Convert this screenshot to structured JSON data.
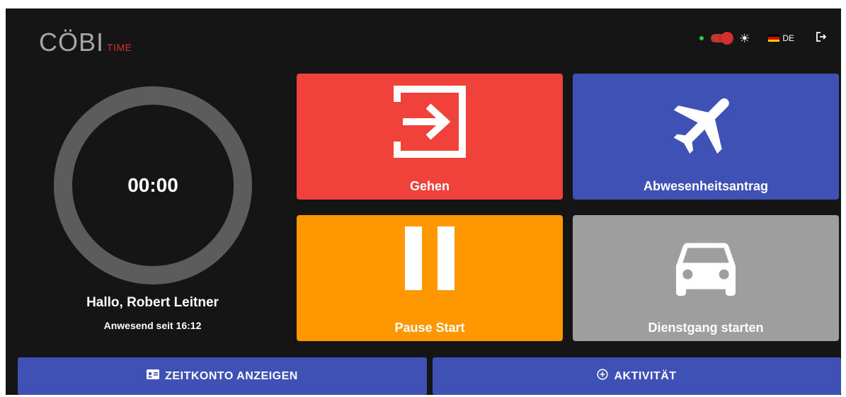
{
  "colors": {
    "background": "#151515",
    "gehen": "#f0413b",
    "absence": "#3f51b5",
    "pause": "#ff9800",
    "errand": "#9e9e9e",
    "button": "#3f51b5",
    "ring": "#5c5c5c"
  },
  "header": {
    "logo_main": "CÖBI",
    "logo_sub": "TIME",
    "language": "DE"
  },
  "timer": {
    "value": "00:00",
    "greeting": "Hallo, Robert Leitner",
    "status": "Anwesend seit 16:12"
  },
  "tiles": [
    {
      "label": "Gehen",
      "icon": "sign-out-icon"
    },
    {
      "label": "Abwesenheitsantrag",
      "icon": "airplane-icon"
    },
    {
      "label": "Pause Start",
      "icon": "pause-icon"
    },
    {
      "label": "Dienstgang starten",
      "icon": "car-icon"
    }
  ],
  "buttons": {
    "zeitkonto": "ZEITKONTO ANZEIGEN",
    "aktivitaet": "AKTIVITÄT"
  }
}
